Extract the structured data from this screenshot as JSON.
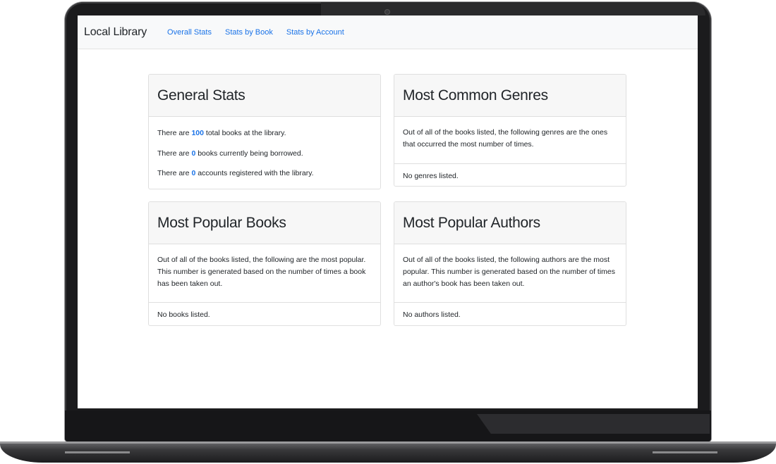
{
  "navbar": {
    "brand": "Local Library",
    "links": [
      "Overall Stats",
      "Stats by Book",
      "Stats by Account"
    ]
  },
  "general_stats": {
    "title": "General Stats",
    "lines": [
      {
        "pre": "There are ",
        "value": "100",
        "post": " total books at the library."
      },
      {
        "pre": "There are ",
        "value": "0",
        "post": " books currently being borrowed."
      },
      {
        "pre": "There are ",
        "value": "0",
        "post": " accounts registered with the library."
      }
    ]
  },
  "common_genres": {
    "title": "Most Common Genres",
    "description": "Out of all of the books listed, the following genres are the ones that occurred the most number of times.",
    "empty": "No genres listed."
  },
  "popular_books": {
    "title": "Most Popular Books",
    "description": "Out of all of the books listed, the following are the most popular. This number is generated based on the number of times a book has been taken out.",
    "empty": "No books listed."
  },
  "popular_authors": {
    "title": "Most Popular Authors",
    "description": "Out of all of the books listed, the following authors are the most popular. This number is generated based on the number of times an author's book has been taken out.",
    "empty": "No authors listed."
  },
  "colors": {
    "accent": "#1a73e8",
    "navbar_bg": "#f8f9fa",
    "card_header_bg": "#f7f7f7",
    "text": "#212529"
  }
}
